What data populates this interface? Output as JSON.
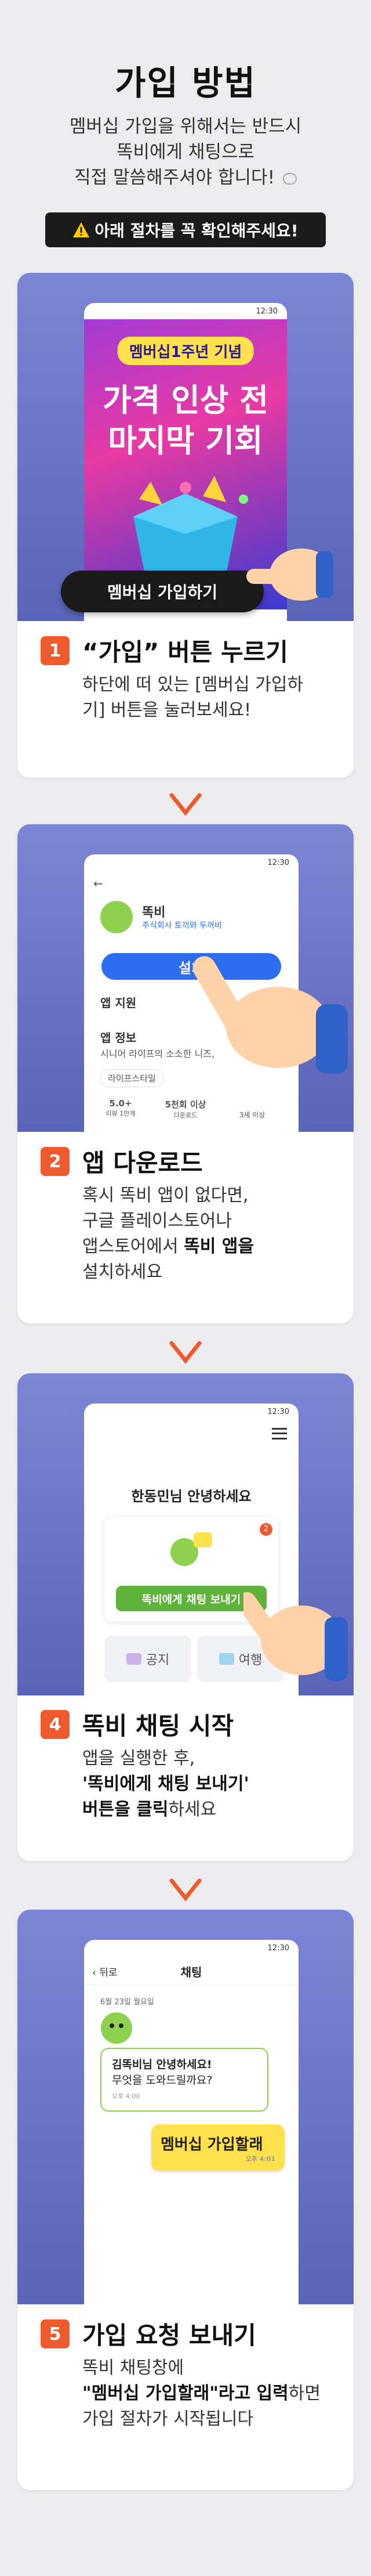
{
  "header": {
    "title": "가입 방법",
    "line1": "멤버십 가입을 위해서는 반드시",
    "line2": "똑비에게 채팅으로",
    "line3": "직접 말씀해주셔야 합니다!",
    "notice": "아래 절차를 꼭 확인해주세요!",
    "notice_icon": "warning-icon"
  },
  "status_time": "12:30",
  "step1": {
    "num": "1",
    "title": "“가입” 버튼 누르기",
    "desc1": "하단에 떠 있는 [멤버십 가입하",
    "desc2": "기] 버튼을 눌러보세요!",
    "promo_badge": "멤버십1주년 기념",
    "promo_line1": "가격 인상 전",
    "promo_line2": "마지막 기회",
    "join_button": "멤버십 가입하기"
  },
  "step2": {
    "num": "2",
    "title": "앱 다운로드",
    "desc1": "혹시 똑비 앱이 없다면,",
    "desc2": "구글 플레이스토어나",
    "desc3_pre": "앱스토어에서 ",
    "desc3_bold": "똑비 앱을",
    "desc4": "설치하세요",
    "app_name": "똑비",
    "app_company": "주식회사 토끼와 두꺼비",
    "install": "설치",
    "app_support": "앱 지원",
    "app_info": "앱 정보",
    "app_info_desc": "시니어 라이프의 소소한 니즈,",
    "chip": "라이프스타일",
    "rating": "5.0+",
    "rating_sub": "리뷰 1만개",
    "downloads": "5천회 이상",
    "downloads_sub": "다운로드",
    "age": "3세 이상"
  },
  "step4": {
    "num": "4",
    "title": "똑비 채팅 시작",
    "desc1": "앱을 실행한 후,",
    "desc2_bold": "'똑비에게 채팅 보내기'",
    "desc3_bold": "버튼을 클릭",
    "desc3_post": "하세요",
    "greeting": "한동민님 안녕하세요",
    "badge": "2",
    "chat_button": "똑비에게 채팅 보내기",
    "tile1": "공지",
    "tile2": "여행"
  },
  "step5": {
    "num": "5",
    "title": "가입 요청 보내기",
    "desc1": "똑비 채팅창에",
    "desc2_bold": "\"멤버십 가입할래\"라고 입력",
    "desc2_post": "하면",
    "desc3": "가입 절차가 시작됩니다",
    "back": "뒤로",
    "chat_title": "채팅",
    "date": "6월 23일 월요일",
    "msg_in1": "김똑비님 안녕하세요!",
    "msg_in2": "무엇을 도와드릴까요?",
    "msg_in_time": "오후 4:00",
    "msg_out": "멤버십 가입할래",
    "msg_out_time": "오후 4:01"
  }
}
